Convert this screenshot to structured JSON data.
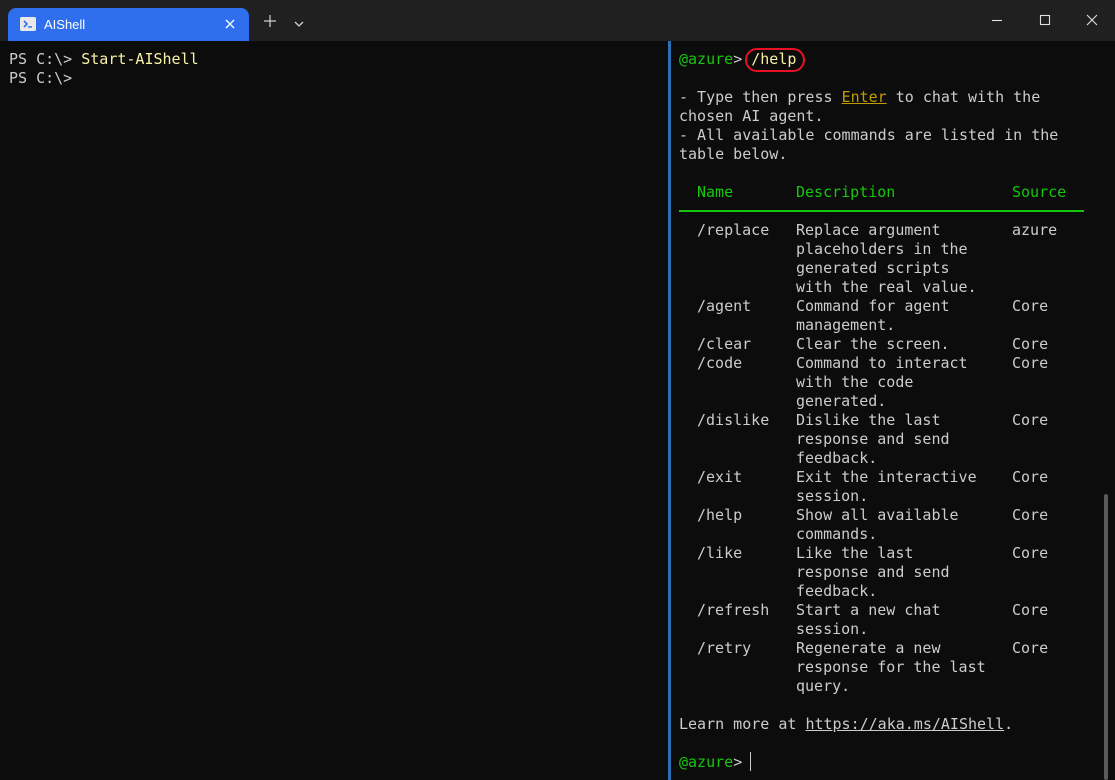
{
  "titlebar": {
    "tab_title": "AIShell",
    "tab_icon": "powershell-icon",
    "new_tab_icon": "plus-icon",
    "dropdown_icon": "chevron-down-icon",
    "window_controls": [
      "minimize-icon",
      "maximize-icon",
      "close-icon"
    ]
  },
  "left_pane": {
    "lines": [
      {
        "prompt": "PS C:\\> ",
        "command": "Start-AIShell"
      },
      {
        "prompt": "PS C:\\> ",
        "command": ""
      }
    ]
  },
  "right_pane": {
    "prompt": "@azure",
    "prompt_sep": "> ",
    "command": "/help",
    "intro": {
      "l1a": "- Type then press ",
      "l1_key": "Enter",
      "l1b": " to chat with the",
      "l2": "chosen AI agent.",
      "l3": "- All available commands are listed in the",
      "l4": "table below."
    },
    "table_headers": {
      "name": "Name",
      "description": "Description",
      "source": "Source"
    },
    "rows": [
      {
        "name": "/replace",
        "desc": [
          "Replace argument",
          "placeholders in the",
          "generated scripts",
          "with the real value."
        ],
        "source": "azure"
      },
      {
        "name": "/agent",
        "desc": [
          "Command for agent",
          "management."
        ],
        "source": "Core"
      },
      {
        "name": "/clear",
        "desc": [
          "Clear the screen."
        ],
        "source": "Core"
      },
      {
        "name": "/code",
        "desc": [
          "Command to interact",
          "with the code",
          "generated."
        ],
        "source": "Core"
      },
      {
        "name": "/dislike",
        "desc": [
          "Dislike the last",
          "response and send",
          "feedback."
        ],
        "source": "Core"
      },
      {
        "name": "/exit",
        "desc": [
          "Exit the interactive",
          "session."
        ],
        "source": "Core"
      },
      {
        "name": "/help",
        "desc": [
          "Show all available",
          "commands."
        ],
        "source": "Core"
      },
      {
        "name": "/like",
        "desc": [
          "Like the last",
          "response and send",
          "feedback."
        ],
        "source": "Core"
      },
      {
        "name": "/refresh",
        "desc": [
          "Start a new chat",
          "session."
        ],
        "source": "Core"
      },
      {
        "name": "/retry",
        "desc": [
          "Regenerate a new",
          "response for the last",
          "query."
        ],
        "source": "Core"
      }
    ],
    "learn_more": "Learn more at ",
    "learn_more_url": "https://aka.ms/AIShell",
    "learn_more_end": ".",
    "final_prompt": "@azure",
    "final_prompt_sep": "> "
  },
  "colors": {
    "tab_active": "#2f6fed",
    "prompt_green": "#16c60c",
    "command_yellow": "#f9f1a5",
    "highlight_red": "#e81123",
    "key_gold": "#c19c00"
  }
}
